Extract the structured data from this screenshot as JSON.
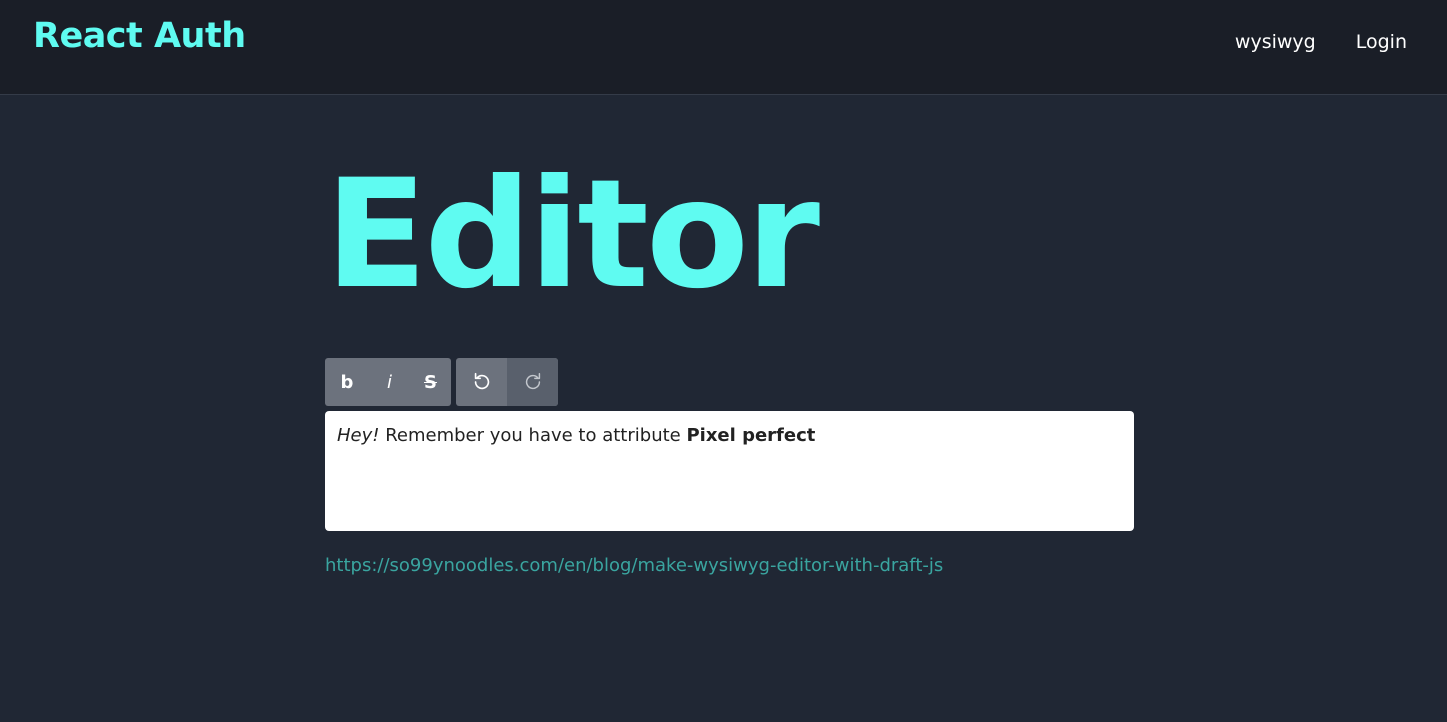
{
  "nav": {
    "brand": "React Auth",
    "links": [
      "wysiwyg",
      "Login"
    ]
  },
  "page": {
    "title": "Editor"
  },
  "toolbar": {
    "format_buttons": [
      {
        "label": "b",
        "icon": "bold-icon"
      },
      {
        "label": "i",
        "icon": "italic-icon"
      },
      {
        "label": "S",
        "icon": "strikethrough-icon"
      }
    ],
    "history_buttons": [
      {
        "icon": "undo-icon",
        "enabled": true
      },
      {
        "icon": "redo-icon",
        "enabled": false
      }
    ]
  },
  "editor": {
    "segments": [
      {
        "text": "Hey!",
        "style": "italic"
      },
      {
        "text": " Remember you have to attribute ",
        "style": "normal"
      },
      {
        "text": "Pixel perfect",
        "style": "bold"
      }
    ]
  },
  "footer": {
    "link_text": "https://so99ynoodles.com/en/blog/make-wysiwyg-editor-with-draft-js"
  },
  "colors": {
    "accent": "#5ffbf1",
    "background": "#202734",
    "navbar": "#1a1e27",
    "link": "#3aa5a0",
    "toolbar": "#6c727d"
  }
}
